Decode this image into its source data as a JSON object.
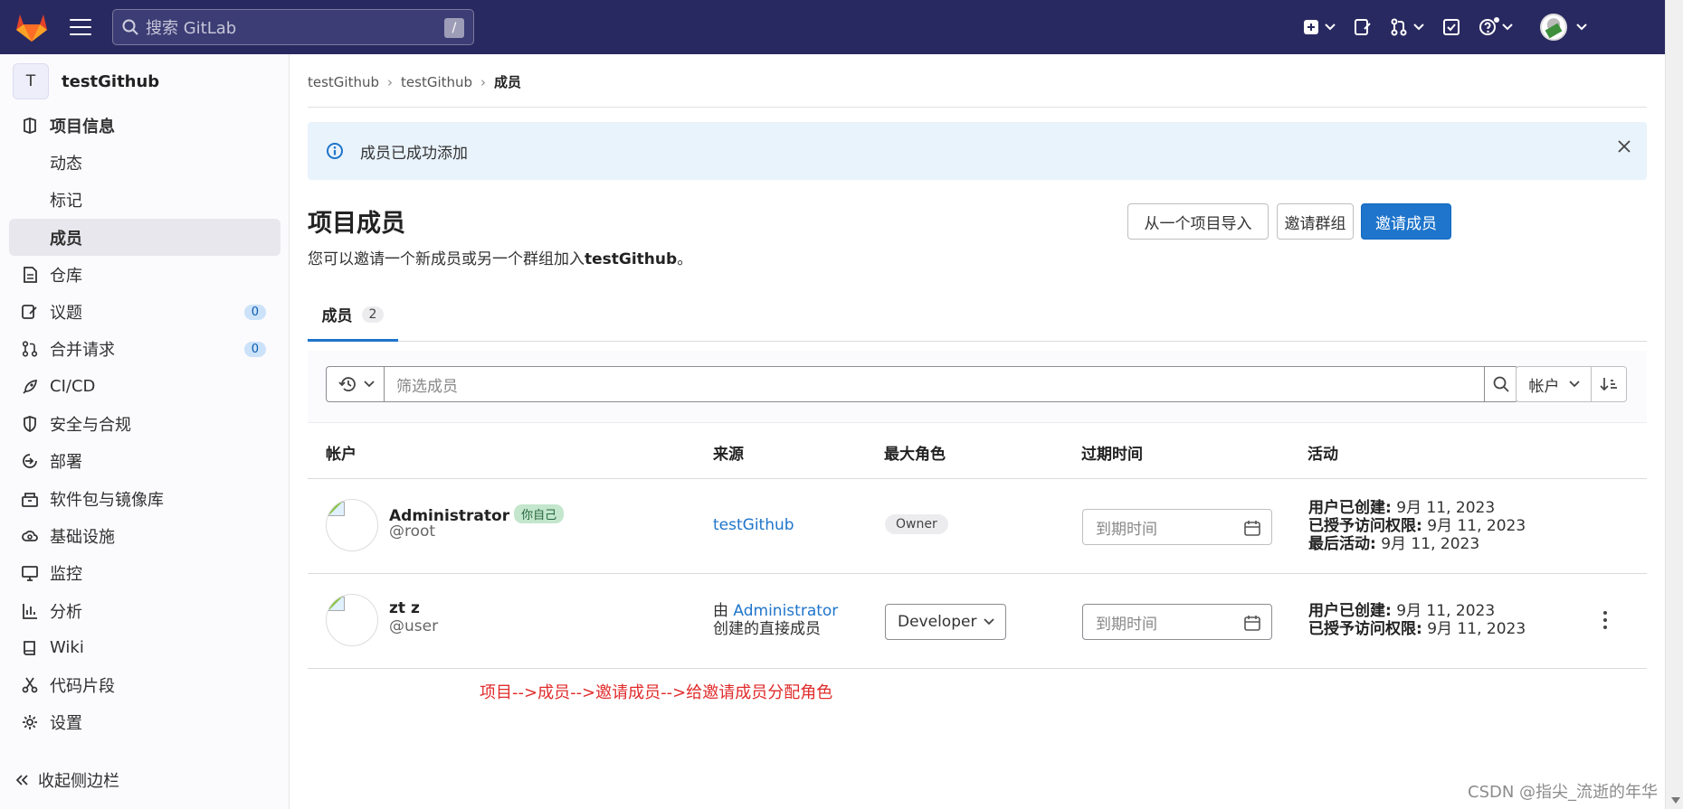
{
  "topbar": {
    "search_placeholder": "搜索 GitLab",
    "shortcut": "/"
  },
  "sidebar": {
    "project_initial": "T",
    "project_name": "testGithub",
    "items": [
      {
        "label": "项目信息",
        "icon": "info-icon"
      },
      {
        "label": "动态"
      },
      {
        "label": "标记"
      },
      {
        "label": "成员"
      },
      {
        "label": "仓库",
        "icon": "doc-icon"
      },
      {
        "label": "议题",
        "icon": "issues-icon",
        "count": "0"
      },
      {
        "label": "合并请求",
        "icon": "merge-icon",
        "count": "0"
      },
      {
        "label": "CI/CD",
        "icon": "rocket-icon"
      },
      {
        "label": "安全与合规",
        "icon": "shield-icon"
      },
      {
        "label": "部署",
        "icon": "deploy-icon"
      },
      {
        "label": "软件包与镜像库",
        "icon": "package-icon"
      },
      {
        "label": "基础设施",
        "icon": "cloud-icon"
      },
      {
        "label": "监控",
        "icon": "monitor-icon"
      },
      {
        "label": "分析",
        "icon": "chart-icon"
      },
      {
        "label": "Wiki",
        "icon": "book-icon"
      },
      {
        "label": "代码片段",
        "icon": "scissors-icon"
      },
      {
        "label": "设置",
        "icon": "gear-icon"
      }
    ],
    "collapse_label": "收起侧边栏"
  },
  "breadcrumb": [
    "testGithub",
    "testGithub",
    "成员"
  ],
  "alert": {
    "message": "成员已成功添加"
  },
  "page": {
    "title": "项目成员",
    "desc_prefix": "您可以邀请一个新成员或另一个群组加入",
    "desc_project": "testGithub",
    "desc_suffix": "。",
    "btn_import": "从一个项目导入",
    "btn_invite_group": "邀请群组",
    "btn_invite_member": "邀请成员"
  },
  "tabs": [
    {
      "label": "成员",
      "count": "2"
    }
  ],
  "filter": {
    "placeholder": "筛选成员",
    "sort_label": "帐户"
  },
  "table": {
    "headers": [
      "帐户",
      "来源",
      "最大角色",
      "过期时间",
      "活动"
    ],
    "rows": [
      {
        "name": "Administrator",
        "self_badge": "你自己",
        "handle": "@root",
        "source": "testGithub",
        "role": "Owner",
        "expiry_placeholder": "到期时间",
        "activity": [
          {
            "label": "用户已创建:",
            "value": " 9月 11, 2023"
          },
          {
            "label": "已授予访问权限:",
            "value": " 9月 11, 2023"
          },
          {
            "label": "最后活动:",
            "value": " 9月 11, 2023"
          }
        ]
      },
      {
        "name": "zt z",
        "handle": "@user",
        "source_prefix": "由 ",
        "source_link": "Administrator",
        "source_suffix": "创建的直接成员",
        "role": "Developer",
        "expiry_placeholder": "到期时间",
        "activity": [
          {
            "label": "用户已创建:",
            "value": " 9月 11, 2023"
          },
          {
            "label": "已授予访问权限:",
            "value": " 9月 11, 2023"
          }
        ]
      }
    ]
  },
  "annotation": "项目-->成员-->邀请成员-->给邀请成员分配角色",
  "watermark": "CSDN @指尖_流逝的年华",
  "colors": {
    "topbar": "#292961",
    "primary": "#1f75cb",
    "annotation": "#e02b2b"
  }
}
